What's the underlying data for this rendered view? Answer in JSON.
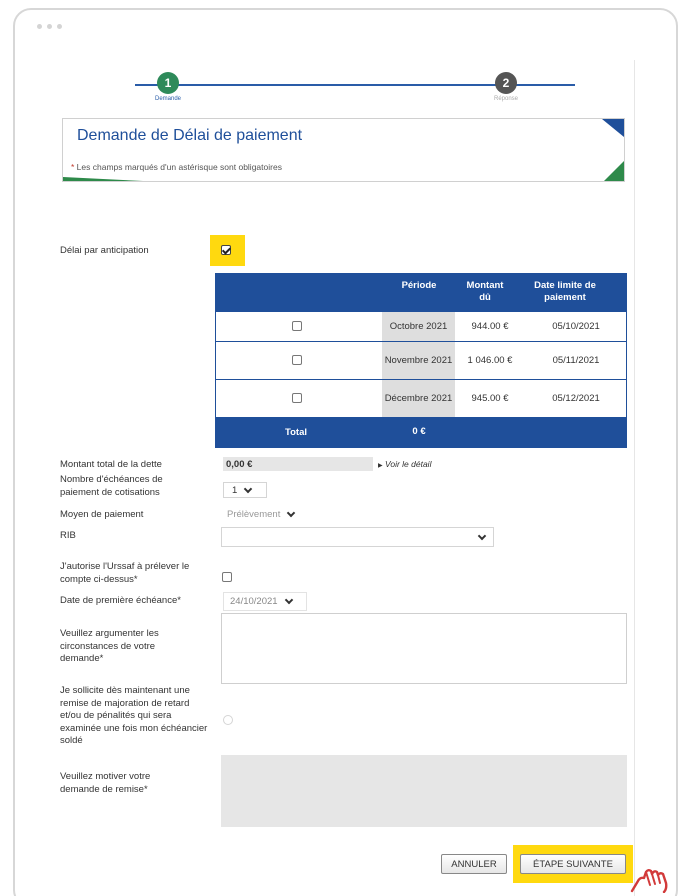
{
  "stepper": {
    "step1": {
      "number": "1",
      "label": "Demande"
    },
    "step2": {
      "number": "2",
      "label": "Réponse"
    }
  },
  "header": {
    "title": "Demande de Délai de paiement",
    "required_asterisk": "*",
    "required_note": " Les champs marqués d'un astérisque sont obligatoires"
  },
  "anticipation": {
    "label": "Délai par anticipation",
    "checked": true
  },
  "table": {
    "columns": [
      "Période",
      "Montant dû",
      "Date limite de paiement"
    ],
    "rows": [
      {
        "periode": "Octobre 2021",
        "montant": "944.00 €",
        "date": "05/10/2021"
      },
      {
        "periode": "Novembre 2021",
        "montant": "1 046.00 €",
        "date": "05/11/2021"
      },
      {
        "periode": "Décembre 2021",
        "montant": "945.00 €",
        "date": "05/12/2021"
      }
    ],
    "total_label": "Total",
    "total_value": "0 €"
  },
  "form": {
    "montant_total": {
      "label": "Montant total de la dette",
      "value": "0,00 €",
      "link": "Voir le détail"
    },
    "nb_echeances": {
      "label": "Nombre d'échéances de paiement de cotisations",
      "value": "1"
    },
    "moyen_paiement": {
      "label": "Moyen de paiement",
      "value": "Prélèvement"
    },
    "rib": {
      "label": "RIB",
      "value": ""
    },
    "autorise": {
      "label": "J'autorise l'Urssaf à prélever le compte ci-dessus*"
    },
    "date_premiere": {
      "label": "Date de première échéance*",
      "value": "24/10/2021"
    },
    "argumenter": {
      "label": "Veuillez argumenter les circonstances de votre demande*"
    },
    "sollicite": {
      "label": "Je sollicite dès maintenant une remise de majoration de retard et/ou de pénalités qui sera examinée une fois mon échéancier soldé"
    },
    "motiver": {
      "label": "Veuillez motiver votre demande de remise*"
    }
  },
  "buttons": {
    "annuler": "ANNULER",
    "etape_suivante": "ÉTAPE SUIVANTE"
  },
  "colors": {
    "primary_blue": "#1f4f9a",
    "accent_green": "#2e8a4a",
    "highlight_yellow": "#ffd90f"
  }
}
